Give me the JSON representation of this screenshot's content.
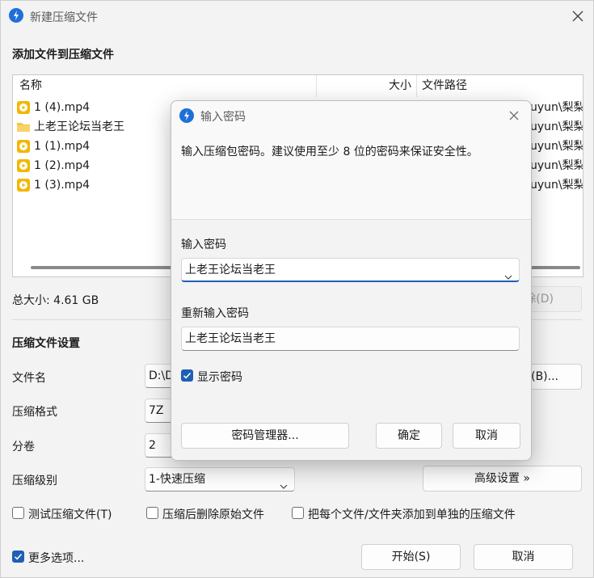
{
  "window": {
    "title": "新建压缩文件",
    "section_files": "添加文件到压缩文件",
    "columns": {
      "name": "名称",
      "size": "大小",
      "path": "文件路径"
    },
    "files": [
      {
        "name": "1 (4).mp4",
        "type": "video",
        "path": "uyun\\梨梨"
      },
      {
        "name": "上老王论坛当老王",
        "type": "folder",
        "path": "uyun\\梨梨"
      },
      {
        "name": "1 (1).mp4",
        "type": "video",
        "path": "uyun\\梨梨"
      },
      {
        "name": "1 (2).mp4",
        "type": "video",
        "path": "uyun\\梨梨"
      },
      {
        "name": "1 (3).mp4",
        "type": "video",
        "path": "uyun\\梨梨"
      }
    ],
    "total_size": "总大小: 4.61 GB",
    "delete_button": "除(D)",
    "section_settings": "压缩文件设置",
    "filename_label": "文件名",
    "filename_value": "D:\\D",
    "browse_button": "(B)...",
    "format_label": "压缩格式",
    "format_value": "7Z",
    "volume_label": "分卷",
    "volume_value": "2",
    "level_label": "压缩级别",
    "level_value": "1-快速压缩",
    "advanced_button": "高级设置 »",
    "test_checkbox": "测试压缩文件(T)",
    "delete_orig_checkbox": "压缩后删除原始文件",
    "each_file_checkbox": "把每个文件/文件夹添加到单独的压缩文件",
    "more_options": "更多选项...",
    "start_button": "开始(S)",
    "cancel_button": "取消"
  },
  "password_dialog": {
    "title": "输入密码",
    "description": "输入压缩包密码。建议使用至少 8 位的密码来保证安全性。",
    "password_label": "输入密码",
    "password_value": "上老王论坛当老王",
    "reenter_label": "重新输入密码",
    "reenter_value": "上老王论坛当老王",
    "show_password": "显示密码",
    "manager_button": "密码管理器...",
    "ok_button": "确定",
    "cancel_button": "取消"
  },
  "colors": {
    "accent": "#1f5fb6",
    "video_icon": "#f2b705",
    "folder_icon": "#f4c542"
  }
}
